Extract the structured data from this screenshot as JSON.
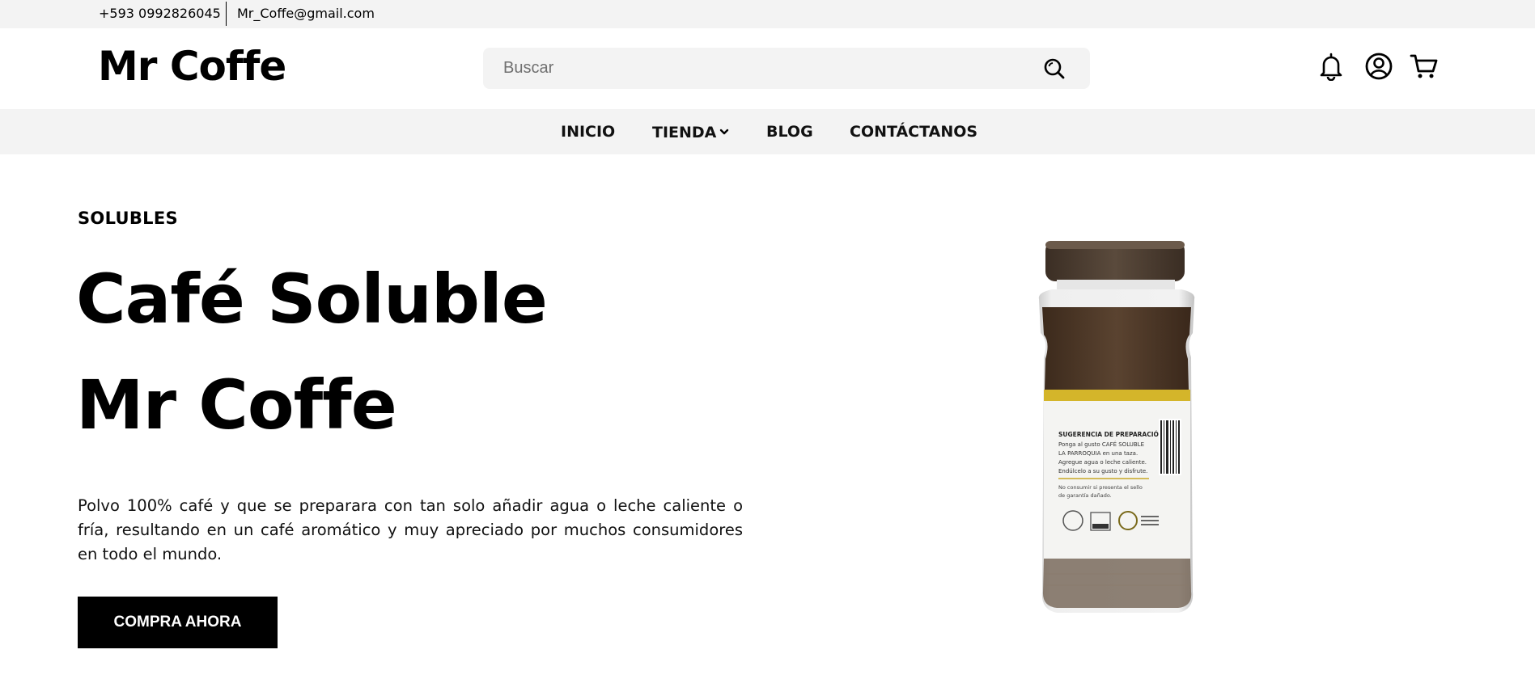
{
  "topbar": {
    "phone": "+593 0992826045",
    "email": "Mr_Coffe@gmail.com"
  },
  "header": {
    "logo": "Mr Coffe",
    "search": {
      "placeholder": "Buscar",
      "value": ""
    },
    "icons": [
      "bell-icon",
      "user-icon",
      "cart-icon"
    ]
  },
  "nav": {
    "items": [
      {
        "label": "INICIO"
      },
      {
        "label": "TIENDA",
        "has_dropdown": true
      },
      {
        "label": "BLOG"
      },
      {
        "label": "CONTÁCTANOS"
      }
    ]
  },
  "hero": {
    "category": "SOLUBLES",
    "title_line1": "Café Soluble",
    "title_line2": "Mr Coffe",
    "description": "Polvo 100% café y que se preparara con tan solo añadir agua o leche caliente o fría, resultando en un café aromático y muy apreciado por muchos consumidores en todo el mundo.",
    "cta_label": "COMPRA AHORA"
  },
  "product_label": {
    "heading": "SUGERENCIA DE PREPARACIÓN",
    "lines": [
      "Ponga al gusto CAFÉ SOLUBLE",
      "LA PARROQUIA en una taza.",
      "Agregue agua o leche caliente.",
      "Endúlcelo a su gusto y disfrute."
    ],
    "warning_lines": [
      "No consumir si presenta el sello",
      "de garantía dañado."
    ]
  },
  "colors": {
    "topbar_bg": "#f3f3f3",
    "nav_bg": "#f3f3f3",
    "cta_bg": "#000000",
    "jar_lid": "#4a3b30",
    "jar_stripe": "#d4b52a"
  }
}
